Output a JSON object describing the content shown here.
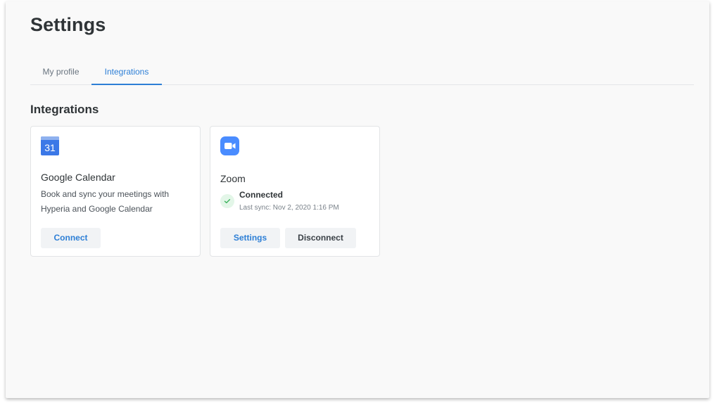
{
  "page": {
    "title": "Settings"
  },
  "tabs": [
    {
      "label": "My profile",
      "active": false
    },
    {
      "label": "Integrations",
      "active": true
    }
  ],
  "section": {
    "title": "Integrations"
  },
  "integrations": [
    {
      "name": "Google Calendar",
      "icon": "google-calendar-icon",
      "icon_text": "31",
      "description": "Book and sync your meetings with Hyperia and Google Calendar",
      "actions": [
        {
          "label": "Connect"
        }
      ]
    },
    {
      "name": "Zoom",
      "icon": "zoom-icon",
      "status": "Connected",
      "last_sync": "Last sync: Nov 2, 2020 1:16 PM",
      "actions": [
        {
          "label": "Settings"
        },
        {
          "label": "Disconnect"
        }
      ]
    }
  ],
  "colors": {
    "accent": "#2d7fd6",
    "title_text": "#2f3437",
    "zoom_brand": "#4a8cff",
    "gcal_brand": "#3b78e7",
    "success_bg": "#e3f6e8",
    "success": "#3cb35c"
  }
}
